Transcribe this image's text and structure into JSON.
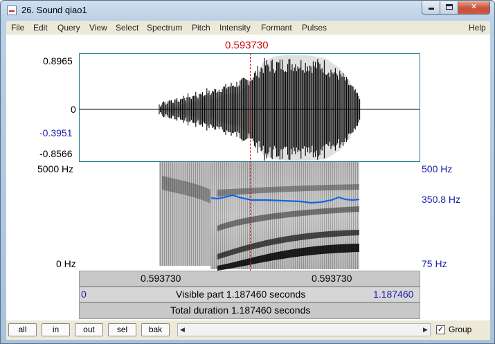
{
  "window": {
    "title": "26. Sound qiao1",
    "min_glyph": "",
    "max_glyph": "",
    "close_glyph": "✕"
  },
  "menu": [
    "File",
    "Edit",
    "Query",
    "View",
    "Select",
    "Spectrum",
    "Pitch",
    "Intensity",
    "Formant",
    "Pulses",
    "Help"
  ],
  "editor": {
    "cursor_time": "0.593730",
    "waveform": {
      "y_max": "0.8965",
      "y_zero": "0",
      "y_min_blue": "-0.3951",
      "y_min": "-0.8566"
    },
    "spectrogram": {
      "freq_top": "5000 Hz",
      "freq_bottom": "0 Hz"
    },
    "pitch": {
      "top": "500 Hz",
      "cursor_value": "350.8 Hz",
      "bottom": "75 Hz"
    },
    "bars": {
      "left_segment": "0.593730",
      "right_segment": "0.593730",
      "visible_start": "0",
      "visible_text": "Visible part 1.187460 seconds",
      "visible_end": "1.187460",
      "total_text": "Total duration 1.187460 seconds"
    }
  },
  "bottom": {
    "buttons": [
      "all",
      "in",
      "out",
      "sel",
      "bak"
    ],
    "scroll_left": "◀",
    "scroll_right": "▶",
    "group_checked": "✓",
    "group_label": "Group"
  },
  "colors": {
    "cursor": "#d01010",
    "pitch_line": "#1565e0",
    "axis_blue": "#1a1aa8",
    "frame_teal": "#1b7a86"
  }
}
